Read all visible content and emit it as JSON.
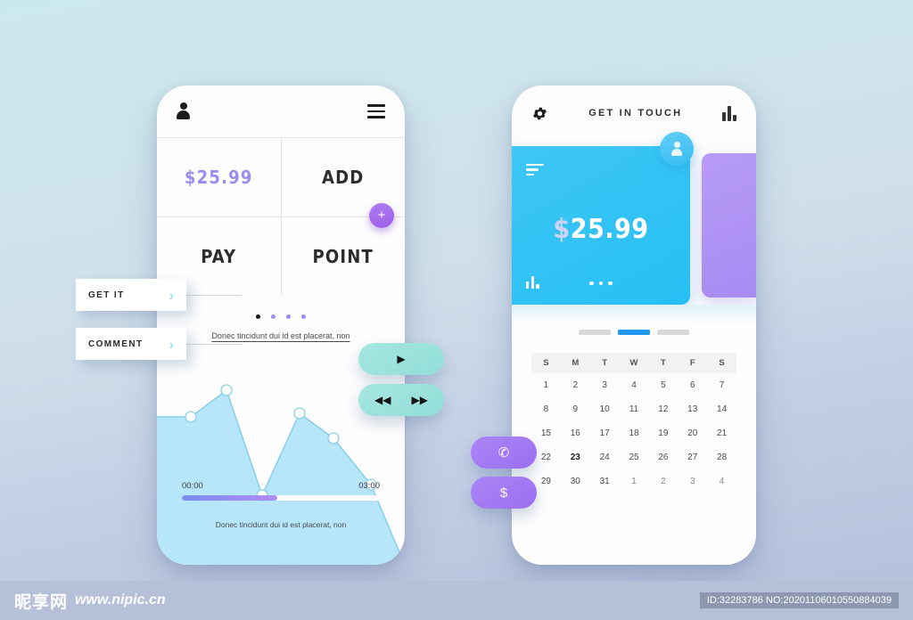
{
  "background": {
    "top_color": "#cbe9ed",
    "bottom_color": "#b5bfdb"
  },
  "left_phone": {
    "header": {
      "avatar_icon": "person-icon",
      "menu_icon": "hamburger-icon"
    },
    "grid": {
      "cells": [
        {
          "label": "$25.99",
          "kind": "price"
        },
        {
          "label": "ADD",
          "kind": "action"
        },
        {
          "label": "PAY",
          "kind": "action"
        },
        {
          "label": "POINT",
          "kind": "action"
        }
      ],
      "fab_label": "+"
    },
    "pagination": {
      "count": 4,
      "active_index": 0
    },
    "caption_top": "Donec tincidunt dui id est placerat, non",
    "caption_bottom": "Donec tincidunt dui id est placerat, non",
    "slider": {
      "start_time": "00:00",
      "end_time": "03:00",
      "progress_percent": 48
    },
    "chart_data": {
      "type": "area",
      "title": "",
      "xlabel": "",
      "ylabel": "",
      "x": [
        0,
        1,
        2,
        3,
        4,
        5,
        6
      ],
      "values": [
        62,
        62,
        88,
        18,
        70,
        50,
        26
      ],
      "ylim": [
        0,
        100
      ],
      "point_indices": [
        1,
        2,
        3,
        4,
        5
      ],
      "grid": false,
      "legend": "none",
      "fill_color": "#b3e5fa",
      "line_color": "#79c9ea",
      "marker_color": "#ffffff"
    }
  },
  "right_phone": {
    "header": {
      "settings_icon": "gear-icon",
      "title": "GET IN TOUCH",
      "stats_icon": "bar-chart-icon"
    },
    "blue_card": {
      "amount_symbol": "$",
      "amount": "25.99",
      "menu_icon": "lines-icon",
      "chart_icon": "bar-chart-icon",
      "more_icon": "ellipsis-icon"
    },
    "avatar_badge_icon": "person-icon",
    "purple_card": {
      "color": "#ad90f4"
    },
    "tabs": {
      "count": 3,
      "active_index": 1,
      "active_color": "#2196f3"
    },
    "calendar": {
      "weekdays": [
        "S",
        "M",
        "T",
        "W",
        "T",
        "F",
        "S"
      ],
      "weeks": [
        [
          {
            "d": "1"
          },
          {
            "d": "2"
          },
          {
            "d": "3"
          },
          {
            "d": "4"
          },
          {
            "d": "5"
          },
          {
            "d": "6"
          },
          {
            "d": "7"
          }
        ],
        [
          {
            "d": "8"
          },
          {
            "d": "9"
          },
          {
            "d": "10"
          },
          {
            "d": "11"
          },
          {
            "d": "12"
          },
          {
            "d": "13"
          },
          {
            "d": "14"
          }
        ],
        [
          {
            "d": "15"
          },
          {
            "d": "16"
          },
          {
            "d": "17"
          },
          {
            "d": "18"
          },
          {
            "d": "19"
          },
          {
            "d": "20"
          },
          {
            "d": "21"
          }
        ],
        [
          {
            "d": "22"
          },
          {
            "d": "23",
            "today": true
          },
          {
            "d": "24"
          },
          {
            "d": "25"
          },
          {
            "d": "26"
          },
          {
            "d": "27"
          },
          {
            "d": "28"
          }
        ],
        [
          {
            "d": "29"
          },
          {
            "d": "30"
          },
          {
            "d": "31"
          },
          {
            "d": "1",
            "muted": true
          },
          {
            "d": "2",
            "muted": true
          },
          {
            "d": "3",
            "muted": true
          },
          {
            "d": "4",
            "muted": true
          }
        ]
      ]
    }
  },
  "floating_buttons": {
    "get_it": {
      "label": "GET IT",
      "chevron": "›"
    },
    "comment": {
      "label": "COMMENT",
      "chevron": "›"
    },
    "play": {
      "icon": "play-icon",
      "glyph": "▶"
    },
    "prev": {
      "icon": "rewind-icon",
      "glyph": "◀◀"
    },
    "next": {
      "icon": "forward-icon",
      "glyph": "▶▶"
    },
    "call": {
      "icon": "phone-icon",
      "glyph": "✆"
    },
    "cash": {
      "icon": "dollar-icon",
      "glyph": "$"
    }
  },
  "watermark": {
    "logo": "昵享网",
    "url": "www.nipic.cn",
    "id_text": "ID:32283786 NO:20201106010550884039"
  }
}
